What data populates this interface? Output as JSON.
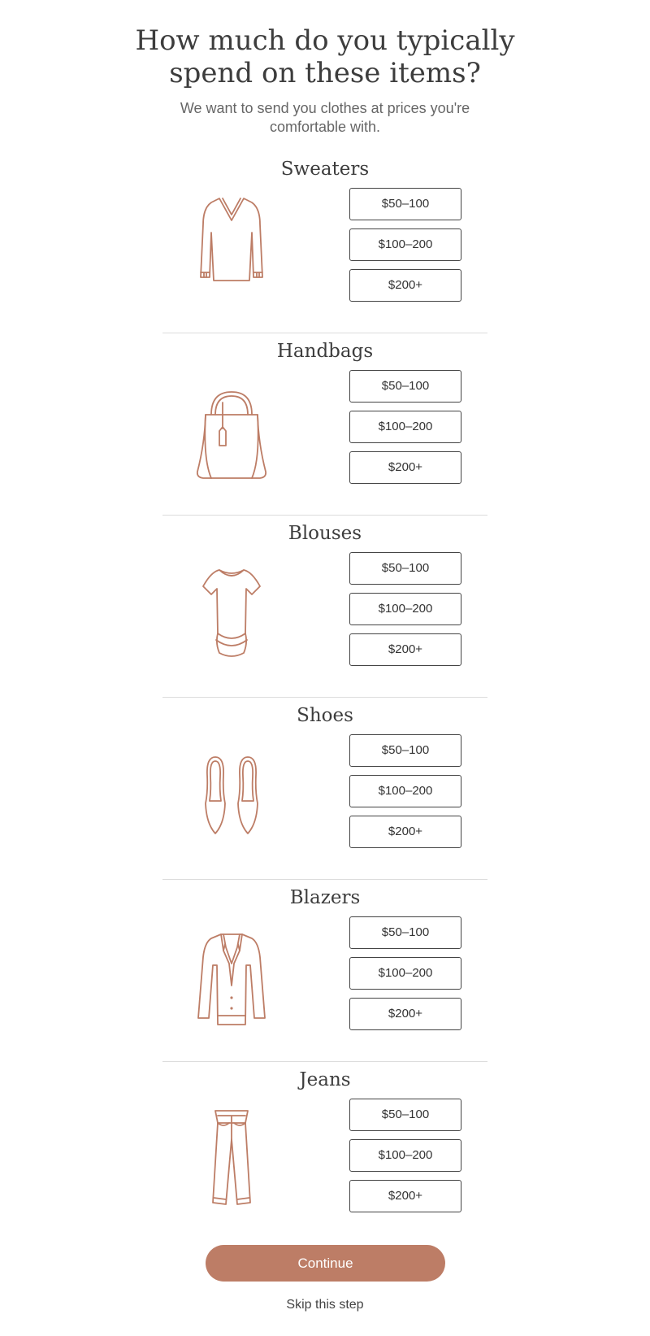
{
  "header": {
    "title_line1": "How much do you typically",
    "title_line2": "spend on these items?",
    "subtitle_line1": "We want to send you clothes at prices you're",
    "subtitle_line2": "comfortable with."
  },
  "price_options": [
    "$50–100",
    "$100–200",
    "$200+"
  ],
  "categories": [
    {
      "name": "Sweaters",
      "icon": "sweater-icon"
    },
    {
      "name": "Handbags",
      "icon": "handbag-icon"
    },
    {
      "name": "Blouses",
      "icon": "blouse-icon"
    },
    {
      "name": "Shoes",
      "icon": "shoes-icon"
    },
    {
      "name": "Blazers",
      "icon": "blazer-icon"
    },
    {
      "name": "Jeans",
      "icon": "jeans-icon"
    }
  ],
  "actions": {
    "continue_label": "Continue",
    "skip_label": "Skip this step"
  },
  "colors": {
    "accent": "#bd7d66",
    "text": "#3d3d3d",
    "divider": "#dcdcdc"
  }
}
